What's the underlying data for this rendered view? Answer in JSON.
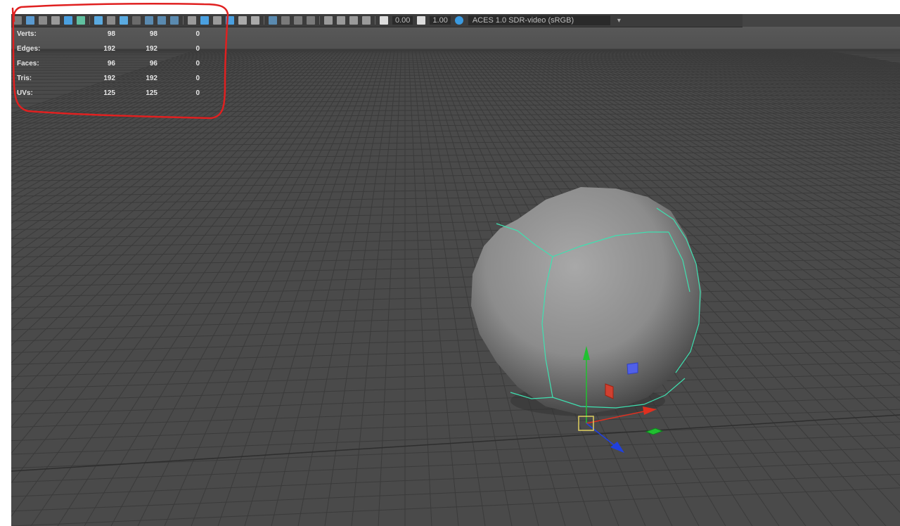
{
  "toolbar": {
    "exposure_value": "0.00",
    "gamma_value": "1.00",
    "color_space": "ACES 1.0 SDR-video (sRGB)",
    "color_space_dropdown_icon": "chevron-down-icon"
  },
  "hud": {
    "rows": [
      {
        "label": "Verts:",
        "values": [
          "98",
          "98",
          "0"
        ]
      },
      {
        "label": "Edges:",
        "values": [
          "192",
          "192",
          "0"
        ]
      },
      {
        "label": "Faces:",
        "values": [
          "96",
          "96",
          "0"
        ]
      },
      {
        "label": "Tris:",
        "values": [
          "192",
          "192",
          "0"
        ]
      },
      {
        "label": "UVs:",
        "values": [
          "125",
          "125",
          "0"
        ]
      }
    ]
  },
  "viewport": {
    "background_color": "#4a4a4a",
    "grid_color": "#3a3a3a",
    "sphere_color": "#8a8a8a",
    "wire_color": "#3fe0b0",
    "axis_x_color": "#e03020",
    "axis_y_color": "#20c030",
    "axis_z_color": "#2040e0",
    "pivot_color": "#e0d060"
  },
  "annotation": {
    "color": "#e02020"
  }
}
